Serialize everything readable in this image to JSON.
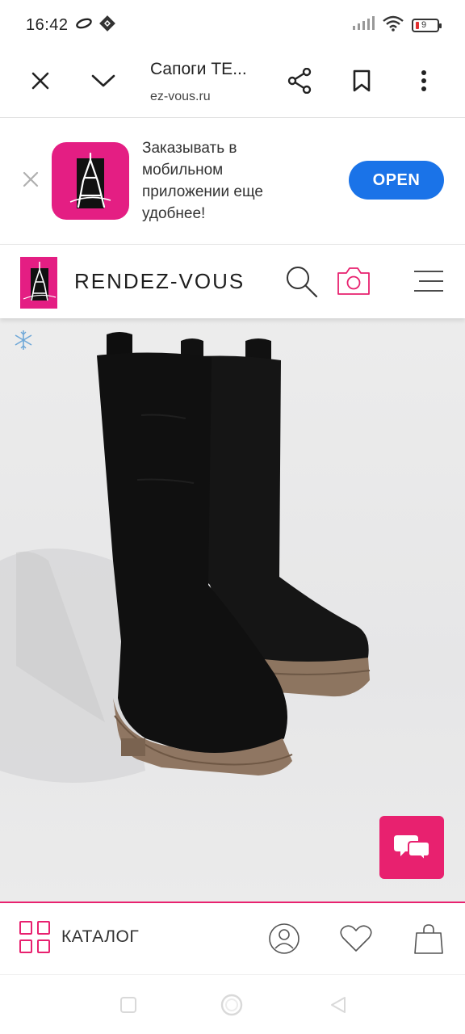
{
  "status": {
    "time": "16:42",
    "battery_level": "9",
    "icons": [
      "infinity-icon",
      "app-notification-icon",
      "signal-icon",
      "wifi-icon",
      "battery-icon"
    ]
  },
  "browser": {
    "page_title": "Сапоги TE...",
    "url": "ez-vous.ru",
    "icons": [
      "close-icon",
      "chevron-down-icon",
      "share-icon",
      "bookmark-icon",
      "more-vert-icon"
    ]
  },
  "app_banner": {
    "text": "Заказывать в мобильном приложении еще удобнее!",
    "open_label": "OPEN",
    "brand_color": "#e41e83",
    "button_color": "#1a73e8"
  },
  "site_header": {
    "brand": "RENDEZ-VOUS",
    "logo_text": "Rendez-Vous",
    "icons": [
      "search-icon",
      "camera-icon",
      "menu-icon"
    ]
  },
  "product": {
    "image_description_icon": "snowflake-icon",
    "chat_icon": "chat-icon",
    "chat_color": "#e8216f"
  },
  "bottom_nav": {
    "catalog_label": "КАТАЛОГ",
    "icons": [
      "catalog-grid-icon",
      "profile-icon",
      "heart-icon",
      "bag-icon"
    ]
  },
  "system_nav": {
    "icons": [
      "recents-icon",
      "home-icon",
      "back-icon"
    ]
  }
}
